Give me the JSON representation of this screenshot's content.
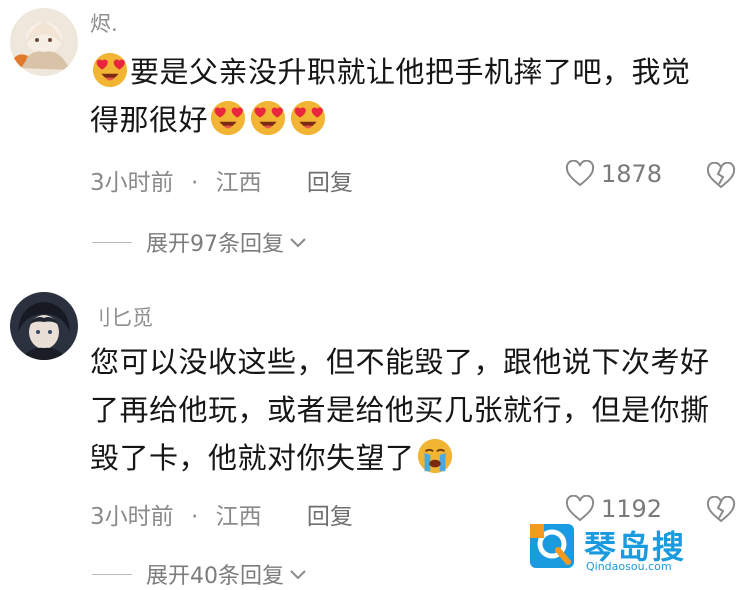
{
  "comments": [
    {
      "username": "烬.",
      "text_line1": "要是父亲没升职就让他把手机摔了吧，我觉",
      "text_line2": "得那很好",
      "time": "3小时前",
      "dot": "·",
      "location": "江西",
      "reply": "回复",
      "likes": "1878",
      "expand": "展开97条回复"
    },
    {
      "username": "刂匕觅",
      "text_line1": "您可以没收这些，但不能毁了，跟他说下次考好",
      "text_line2": "了再给他玩，或者是给他买几张就行，但是你撕",
      "text_line3": "毁了卡，他就对你失望了",
      "time": "3小时前",
      "dot": "·",
      "location": "江西",
      "reply": "回复",
      "likes": "1192",
      "expand": "展开40条回复"
    }
  ],
  "watermark": {
    "cn": "琴岛搜",
    "url": "Qindaosou.com"
  },
  "colors": {
    "meta": "#8a8a8a",
    "text": "#161616",
    "watermark_blue": "#1a9be0",
    "watermark_orange": "#f39a1e",
    "emoji_face": "#f2b533",
    "emoji_heart": "#e8263d"
  }
}
